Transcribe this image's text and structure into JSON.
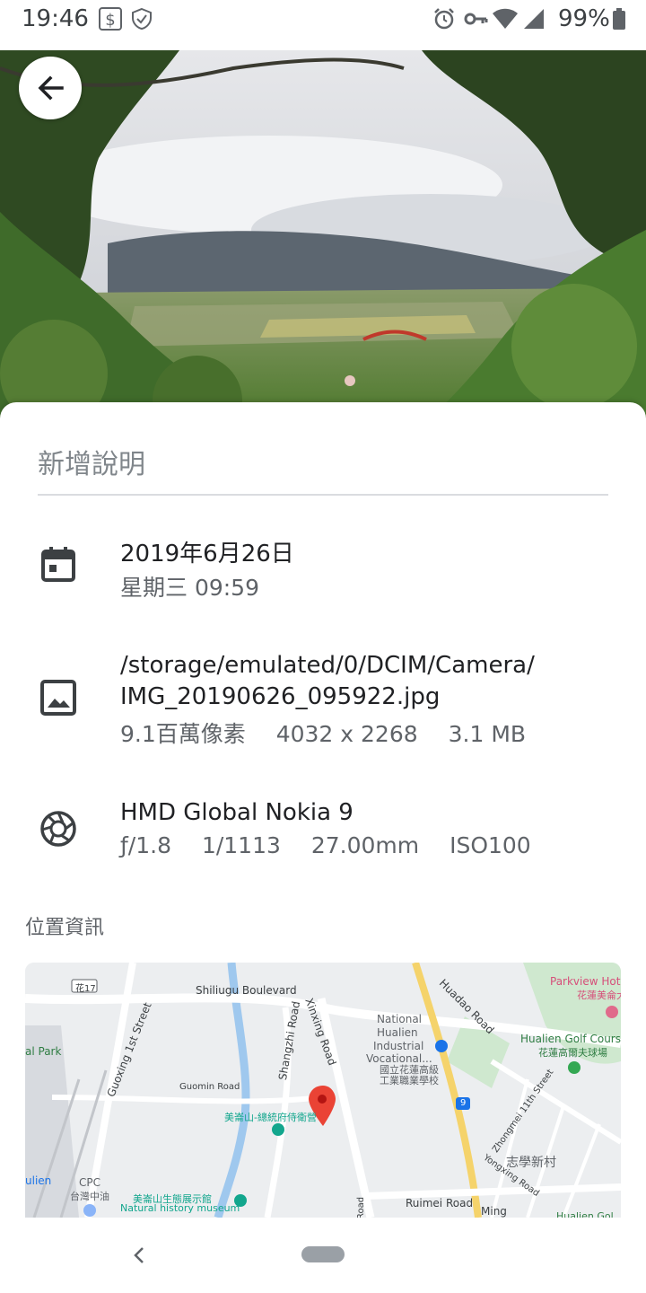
{
  "status_bar": {
    "time": "19:46",
    "battery_percent": "99%",
    "icons": [
      "dollar-notification-icon",
      "shield-notification-icon",
      "alarm-icon",
      "vpn-key-icon",
      "wifi-icon",
      "signal-icon",
      "battery-icon"
    ]
  },
  "photo": {
    "description_icon": "landscape-photo",
    "back_icon": "arrow-back-icon"
  },
  "caption": {
    "placeholder": "新增說明"
  },
  "details": {
    "date": {
      "icon": "calendar-icon",
      "date": "2019年6月26日",
      "time": "星期三 09:59"
    },
    "file": {
      "icon": "image-icon",
      "path_line1": "/storage/emulated/0/DCIM/Camera/",
      "path_line2": "IMG_20190626_095922.jpg",
      "megapixels": "9.1百萬像素",
      "resolution": "4032 x 2268",
      "size": "3.1 MB"
    },
    "camera": {
      "icon": "camera-shutter-icon",
      "model": "HMD Global Nokia 9",
      "aperture": "ƒ/1.8",
      "shutter": "1/1113",
      "focal_length": "27.00mm",
      "iso": "ISO100"
    }
  },
  "location": {
    "title": "位置資訊",
    "map_labels": {
      "shiliugu": "Shiliugu Boulevard",
      "xinxing": "Xinxing Road",
      "shangzhi": "Shangzhi Road",
      "huadao": "Huadao Road",
      "guoxing": "Guoxing 1st Street",
      "guomin": "Guomin Road",
      "school_en1": "National",
      "school_en2": "Hualien",
      "school_en3": "Industrial",
      "school_en4": "Vocational...",
      "school_zh1": "國立花蓮高級",
      "school_zh2": "工業職業學校",
      "parkview_en": "Parkview Hot",
      "parkview_zh": "花蓮美侖大",
      "golf_en": "Hualien Golf Cours",
      "golf_zh": "花蓮高爾夫球場",
      "park": "al Park",
      "museum_zh": "美崙山-總統府侍衛營",
      "eco_zh": "美崙山生態展示館",
      "eco_en": "Natural history museum",
      "cpc_en": "CPC",
      "cpc_zh": "台灣中油",
      "ruimei": "Ruimei Road",
      "zhiyue": "志學新村",
      "yongxing": "Yongxing Road",
      "zhongmei": "Zhongmei 11th Street",
      "route17": "花17",
      "route9": "9",
      "hualien_station": "ulien",
      "mingy": "Ming",
      "road_bottom": "Road",
      "hualien_cut": "Hualien Gol"
    }
  },
  "colors": {
    "accent": "#1a73e8",
    "text_primary": "#202124",
    "text_secondary": "#5f6368",
    "pin": "#ea4335"
  }
}
